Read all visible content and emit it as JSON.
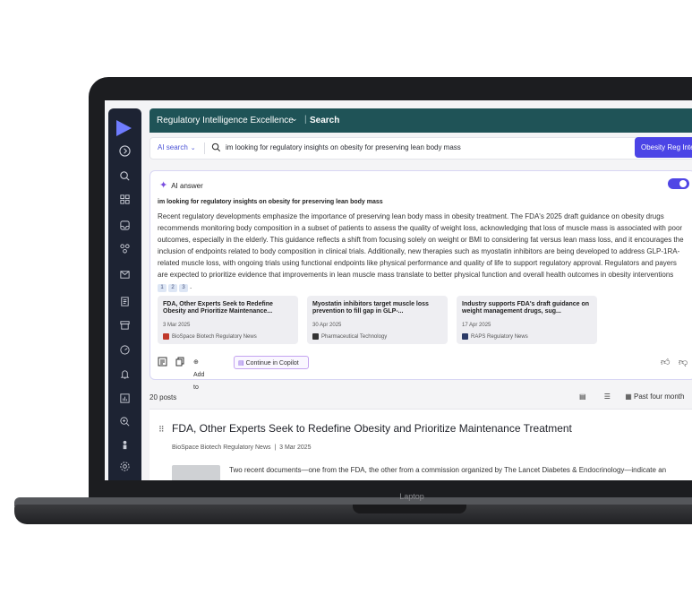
{
  "device": {
    "brand": "Laptop"
  },
  "header": {
    "workspace": "Regulatory Intelligence Excellence",
    "breadcrumb": "Search"
  },
  "search": {
    "mode": "AI search",
    "query": "im looking for regulatory insights on obesity for preserving lean body mass",
    "button": "Obesity Reg Inte"
  },
  "ai_answer": {
    "label": "AI answer",
    "question": "im looking for regulatory insights on obesity for preserving lean body mass",
    "body": "Recent regulatory developments emphasize the importance of preserving lean body mass in obesity treatment. The FDA's 2025 draft guidance on obesity drugs recommends monitoring body composition in a subset of patients to assess the quality of weight loss, acknowledging that loss of muscle mass is associated with poor outcomes, especially in the elderly. This guidance reflects a shift from focusing solely on weight or BMI to considering fat versus lean mass loss, and it encourages the inclusion of endpoints related to body composition in clinical trials. Additionally, new therapies such as myostatin inhibitors are being developed to address GLP-1RA-related muscle loss, with ongoing trials using functional endpoints like physical performance and quality of life to support regulatory approval. Regulators and payers are expected to prioritize evidence that improvements in lean muscle mass translate to better physical function and overall health outcomes in obesity interventions",
    "citations": [
      "1",
      "2",
      "3"
    ],
    "sources": [
      {
        "title": "FDA, Other Experts Seek to Redefine Obesity and Prioritize Maintenance...",
        "date": "3 Mar 2025",
        "publisher": "BioSpace Biotech Regulatory News"
      },
      {
        "title": "Myostatin inhibitors target muscle loss prevention to fill gap in GLP-...",
        "date": "30 Apr 2025",
        "publisher": "Pharmaceutical Technology"
      },
      {
        "title": "Industry supports FDA's draft guidance on weight management drugs, sug...",
        "date": "17 Apr 2025",
        "publisher": "RAPS Regulatory News"
      }
    ],
    "actions": {
      "add": "Add to",
      "copilot": "Continue in Copilot"
    }
  },
  "results": {
    "count": "20 posts",
    "filter": "Past four month",
    "items": [
      {
        "title": "FDA, Other Experts Seek to Redefine Obesity and Prioritize Maintenance Treatment",
        "source": "BioSpace Biotech Regulatory News",
        "date": "3 Mar 2025",
        "snippet": "Two recent documents—one from the FDA, the other from a commission organized by The Lancet Diabetes & Endocrinology—indicate an"
      }
    ]
  },
  "colors": {
    "sidebar": "#1d2333",
    "header": "#1f5357",
    "accent": "#4b44e6"
  }
}
